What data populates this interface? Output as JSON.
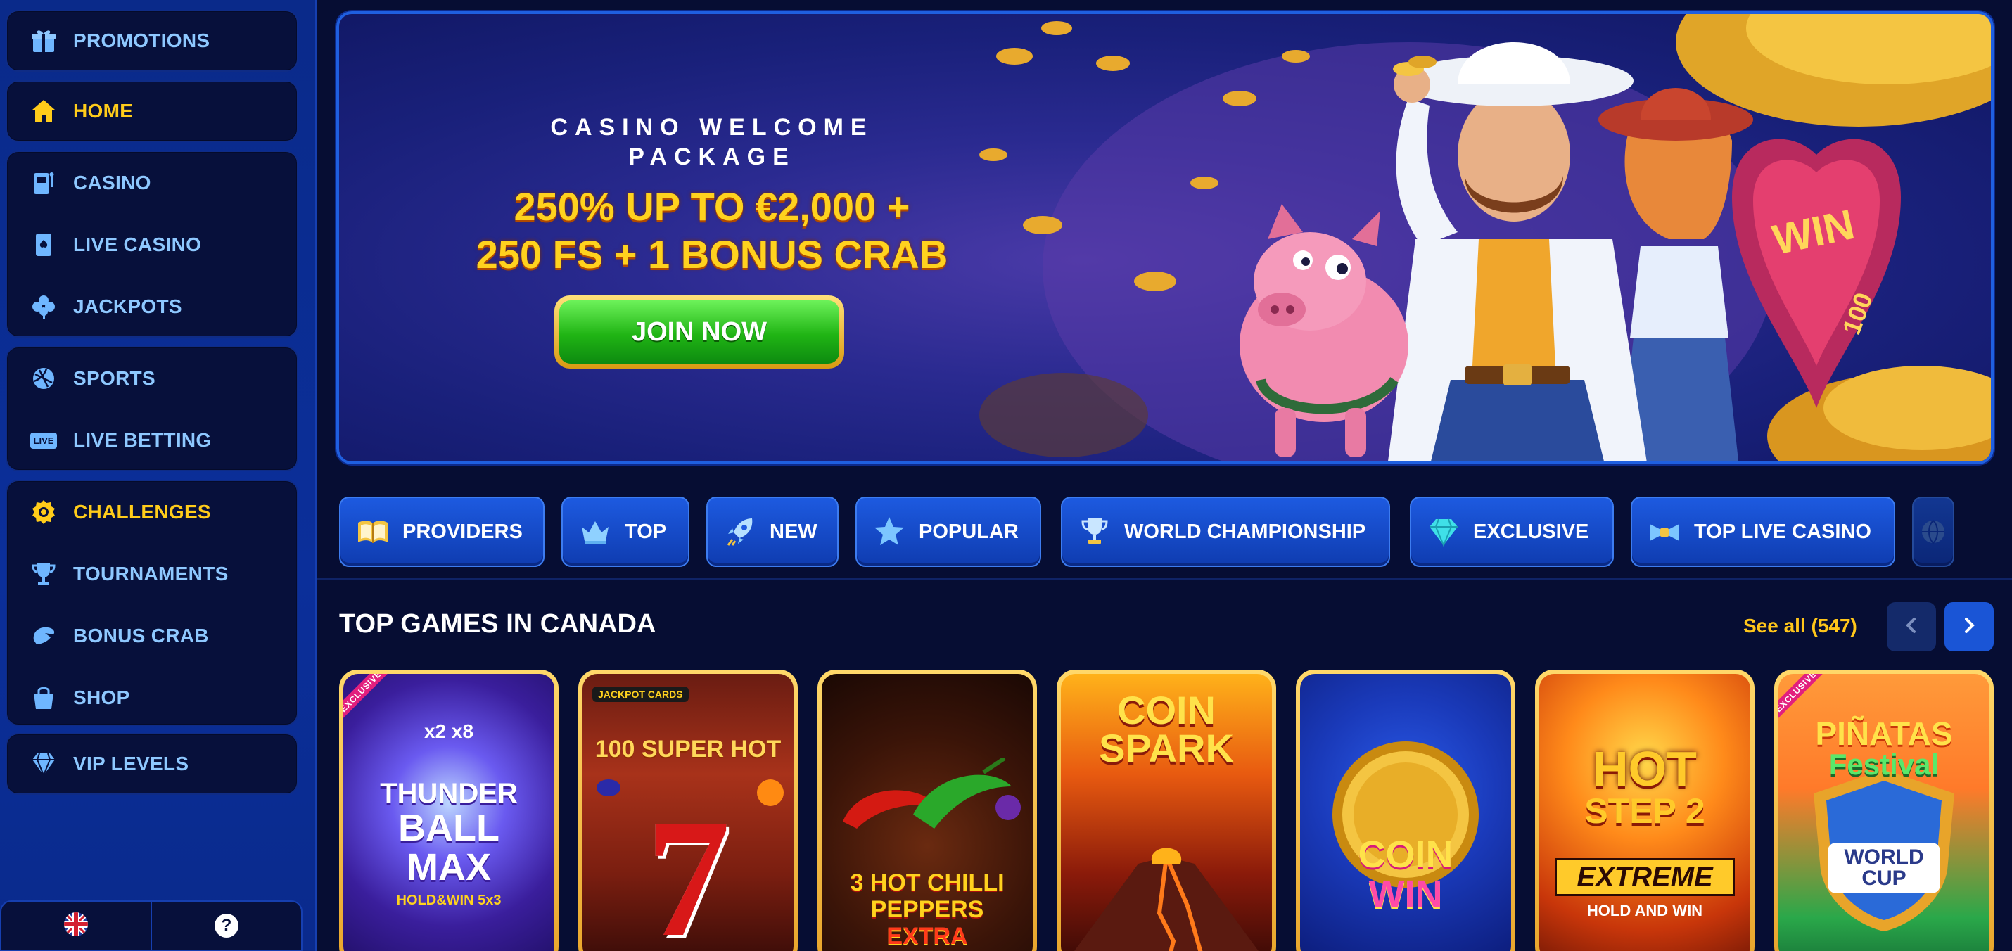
{
  "sidebar": {
    "items": [
      {
        "label": "PROMOTIONS",
        "icon": "gift-icon"
      },
      {
        "label": "HOME",
        "icon": "home-icon"
      },
      {
        "label": "CASINO",
        "icon": "slot-machine-icon"
      },
      {
        "label": "LIVE CASINO",
        "icon": "playing-card-icon"
      },
      {
        "label": "JACKPOTS",
        "icon": "clover-icon"
      },
      {
        "label": "SPORTS",
        "icon": "ball-icon"
      },
      {
        "label": "LIVE BETTING",
        "icon": "live-icon",
        "icon_text": "LIVE"
      },
      {
        "label": "CHALLENGES",
        "icon": "medal-icon"
      },
      {
        "label": "TOURNAMENTS",
        "icon": "trophy-icon"
      },
      {
        "label": "BONUS CRAB",
        "icon": "crab-claw-icon"
      },
      {
        "label": "SHOP",
        "icon": "shopping-bag-icon"
      },
      {
        "label": "VIP LEVELS",
        "icon": "diamond-icon"
      }
    ],
    "bottom": {
      "language_icon": "uk-flag-icon",
      "help_text": "?"
    }
  },
  "hero": {
    "kicker": "CASINO WELCOME PACKAGE",
    "offer_line1": "250% UP TO €2,000 +",
    "offer_line2": "250 FS + 1 BONUS CRAB",
    "cta": "JOIN NOW",
    "sign_text": "WIN",
    "wheel_number": "100"
  },
  "tabs": [
    {
      "label": "PROVIDERS",
      "icon": "book-icon"
    },
    {
      "label": "TOP",
      "icon": "crown-icon"
    },
    {
      "label": "NEW",
      "icon": "rocket-icon"
    },
    {
      "label": "POPULAR",
      "icon": "star-icon"
    },
    {
      "label": "WORLD CHAMPIONSHIP",
      "icon": "trophy-icon"
    },
    {
      "label": "EXCLUSIVE",
      "icon": "diamond-icon"
    },
    {
      "label": "TOP LIVE CASINO",
      "icon": "bow-tie-icon"
    }
  ],
  "top_games": {
    "title": "TOP GAMES IN CANADA",
    "see_all": "See all (547)",
    "games": [
      {
        "title_lines": [
          "THUNDER",
          "BALL",
          "MAX"
        ],
        "sub": "HOLD&WIN 5x3",
        "badge": "EXCLUSIVE",
        "extra": "x2  x8"
      },
      {
        "title_lines": [
          "100 SUPER HOT"
        ],
        "sub": "7",
        "badge": "",
        "extra": "JACKPOT CARDS"
      },
      {
        "title_lines": [
          "3 HOT CHILLI",
          "PEPPERS",
          "EXTRA"
        ],
        "sub": "",
        "badge": "",
        "extra": ""
      },
      {
        "title_lines": [
          "COIN",
          "SPARK"
        ],
        "sub": "",
        "badge": "",
        "extra": ""
      },
      {
        "title_lines": [
          "COIN",
          "WIN"
        ],
        "sub": "",
        "badge": "",
        "extra": ""
      },
      {
        "title_lines": [
          "HOT",
          "STEP 2"
        ],
        "sub": "EXTREME",
        "badge": "",
        "extra": "HOLD AND WIN"
      },
      {
        "title_lines": [
          "PIÑATAS",
          "Festival"
        ],
        "sub": "WORLD CUP",
        "badge": "EXCLUSIVE",
        "extra": ""
      }
    ]
  },
  "colors": {
    "accent_gold": "#ffcc1a",
    "nav_blue": "#8ec8ff",
    "cta_green": "#20b414",
    "tab_blue": "#1d5ae0"
  }
}
